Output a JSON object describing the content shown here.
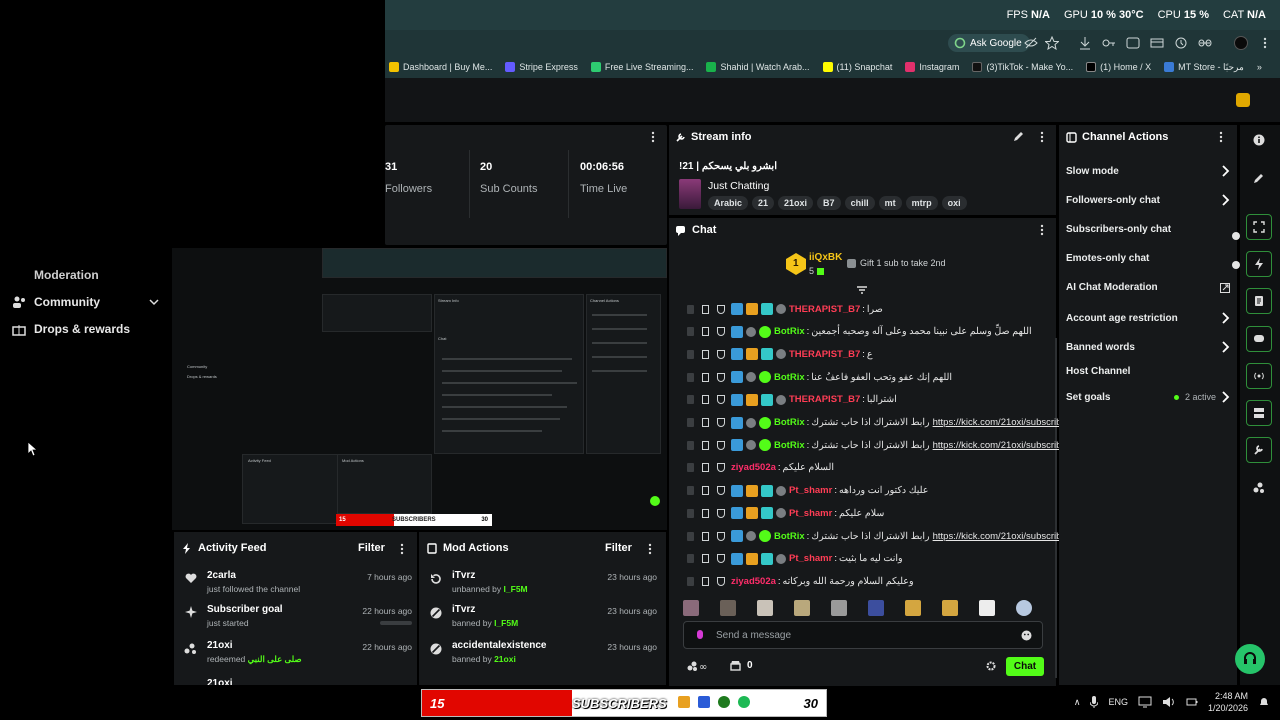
{
  "perf": {
    "fps_label": "FPS",
    "fps_value": "N/A",
    "gpu_label": "GPU",
    "gpu_value": "10 %",
    "gpu_temp": "30°C",
    "cpu_label": "CPU",
    "cpu_value": "15 %",
    "cpu_temp_label": "CAT",
    "cpu_temp": "N/A"
  },
  "browser": {
    "ask_google": "Ask Google",
    "bookmarks": [
      "Dashboard | Buy Me...",
      "Stripe Express",
      "Free Live Streaming...",
      "Shahid | Watch Arab...",
      "(11) Snapchat",
      "Instagram",
      "(3)TikTok - Make Yo...",
      "(1) Home / X",
      "MT Store - مرحبًا"
    ]
  },
  "left_nav": {
    "moderation": "Moderation",
    "community": "Community",
    "drops": "Drops & rewards"
  },
  "preview": {
    "community": "Community",
    "drops": "Drops & rewards",
    "activity": "Activity Feed",
    "mod_actions": "Mod Actions",
    "stream_info": "Stream Info",
    "chat": "Chat",
    "channel_actions": "Channel Actions",
    "subs": "SUBSCRIBERS",
    "subs_left": "15",
    "subs_right": "30"
  },
  "stats": {
    "items": [
      {
        "value": "31",
        "label": "Followers"
      },
      {
        "value": "20",
        "label": "Sub Counts"
      },
      {
        "value": "00:06:56",
        "label": "Time Live"
      }
    ]
  },
  "stream_info": {
    "title": "Stream info",
    "stream_title": "ابشرو بلي يسحكم | 21!",
    "category": "Just Chatting",
    "tags": [
      "Arabic",
      "21",
      "21oxi",
      "B7",
      "chill",
      "mt",
      "mtrp",
      "oxi"
    ]
  },
  "chat": {
    "title": "Chat",
    "gifter_name": "iiQxBK",
    "gifter_rank": "1",
    "gifter_count": "5",
    "gift_text": "Gift 1 sub to take 2nd",
    "placeholder": "Send a message",
    "points": "0",
    "send": "Chat",
    "messages": [
      {
        "user": "THERAPIST_B7",
        "color": "#ff3d55",
        "text": "صرا",
        "type": "full"
      },
      {
        "user": "BotRix",
        "color": "#53fc18",
        "text": "اللهم صلِّ وسلم على نبينا محمد وعلى آله وصحبه أجمعين",
        "type": "bot"
      },
      {
        "user": "THERAPIST_B7",
        "color": "#ff3d55",
        "text": "ع",
        "type": "full"
      },
      {
        "user": "BotRix",
        "color": "#53fc18",
        "text": "اللهم إنك عفو وتحب العفو فاعفُ عنا",
        "type": "bot"
      },
      {
        "user": "THERAPIST_B7",
        "color": "#ff3d55",
        "text": "اشترالبا",
        "type": "full"
      },
      {
        "user": "BotRix",
        "color": "#53fc18",
        "text": "رابط الاشتراك اذا حاب تشترك",
        "link": "https://kick.com/21oxi/subscribe",
        "type": "bot"
      },
      {
        "user": "BotRix",
        "color": "#53fc18",
        "text": "رابط الاشتراك اذا حاب تشترك",
        "link": "https://kick.com/21oxi/subscribe",
        "type": "bot"
      },
      {
        "user": "ziyad502a",
        "color": "#ff2d6a",
        "text": "السلام عليكم",
        "type": "min"
      },
      {
        "user": "Pt_shamr",
        "color": "#ff3d55",
        "text": "عليك دكتور انت ورداهه",
        "type": "full"
      },
      {
        "user": "Pt_shamr",
        "color": "#ff3d55",
        "text": "سلام عليكم",
        "type": "full"
      },
      {
        "user": "BotRix",
        "color": "#53fc18",
        "text": "رابط الاشتراك اذا حاب تشترك",
        "link": "https://kick.com/21oxi/subscribe",
        "type": "bot"
      },
      {
        "user": "Pt_shamr",
        "color": "#ff3d55",
        "text": "وانت ليه ما بثيت",
        "type": "full"
      },
      {
        "user": "ziyad502a",
        "color": "#ff2d6a",
        "text": "وعليكم السلام ورحمة الله وبركاته",
        "type": "min"
      }
    ]
  },
  "channel_actions": {
    "title": "Channel Actions",
    "items": [
      {
        "label": "Slow mode",
        "kind": "arrow"
      },
      {
        "label": "Followers-only chat",
        "kind": "arrow"
      },
      {
        "label": "Subscribers-only chat",
        "kind": "toggle"
      },
      {
        "label": "Emotes-only chat",
        "kind": "toggle"
      },
      {
        "label": "AI Chat Moderation",
        "kind": "external"
      },
      {
        "label": "Account age restriction",
        "kind": "arrow"
      },
      {
        "label": "Banned words",
        "kind": "arrow"
      },
      {
        "label": "Host Channel",
        "kind": "none"
      },
      {
        "label": "Set goals",
        "kind": "goals"
      }
    ],
    "goals_active": "2 active"
  },
  "activity_feed": {
    "title": "Activity Feed",
    "filter": "Filter",
    "items": [
      {
        "name": "2carla",
        "sub": "just followed the channel",
        "time": "7 hours ago",
        "icon": "heart-icon"
      },
      {
        "name": "Subscriber goal",
        "sub": "just started",
        "time": "22 hours ago",
        "icon": "sparkle-icon"
      },
      {
        "name": "21oxi",
        "sub": "redeemed",
        "extra": "صلى على النبي",
        "time": "22 hours ago",
        "icon": "coins-icon"
      }
    ]
  },
  "mod_actions": {
    "title": "Mod Actions",
    "filter": "Filter",
    "items": [
      {
        "name": "iTvrz",
        "sub": "unbanned by",
        "by": "I_F5M",
        "time": "23 hours ago",
        "icon": "undo-icon"
      },
      {
        "name": "iTvrz",
        "sub": "banned by",
        "by": "I_F5M",
        "time": "23 hours ago",
        "icon": "ban-icon"
      },
      {
        "name": "accidentalexistence",
        "sub": "banned by",
        "by": "21oxi",
        "time": "23 hours ago",
        "icon": "ban-icon"
      }
    ]
  },
  "taskbar": {
    "subs_left": "15",
    "subs_label": "SUBSCRIBERS",
    "subs_right": "30",
    "lang": "ENG",
    "time": "2:48 AM",
    "date": "1/20/2026"
  },
  "colors": {
    "accent": "#53fc18",
    "panel": "#16181a",
    "red": "#e10600"
  }
}
